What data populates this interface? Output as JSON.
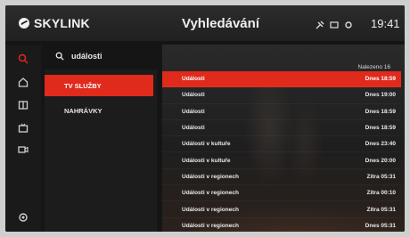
{
  "header": {
    "brand": "SKYLINK",
    "title": "Vyhledávání",
    "clock": "19:41"
  },
  "search": {
    "query": "události"
  },
  "categories": [
    {
      "label": "TV SLUŽBY",
      "active": true
    },
    {
      "label": "NAHRÁVKY",
      "active": false
    }
  ],
  "results_count": "Nalezeno 16",
  "results": [
    {
      "title": "Události",
      "time": "Dnes 18:59",
      "active": true
    },
    {
      "title": "Události",
      "time": "Dnes 19:00",
      "active": false
    },
    {
      "title": "Události",
      "time": "Dnes 18:59",
      "active": false
    },
    {
      "title": "Události",
      "time": "Dnes 18:59",
      "active": false
    },
    {
      "title": "Události v kultuře",
      "time": "Dnes 23:40",
      "active": false
    },
    {
      "title": "Události v kultuře",
      "time": "Dnes 20:00",
      "active": false
    },
    {
      "title": "Události v regionech",
      "time": "Zítra 05:31",
      "active": false
    },
    {
      "title": "Události v regionech",
      "time": "Zítra 00:10",
      "active": false
    },
    {
      "title": "Události v regionech",
      "time": "Zítra 05:31",
      "active": false
    },
    {
      "title": "Události v regionech",
      "time": "Dnes 05:31",
      "active": false
    }
  ],
  "colors": {
    "accent": "#e02a1c",
    "background": "#151515"
  },
  "sidebar_icons": [
    "search-icon",
    "home-icon",
    "guide-icon",
    "tv-icon",
    "recording-icon",
    "settings-icon"
  ]
}
